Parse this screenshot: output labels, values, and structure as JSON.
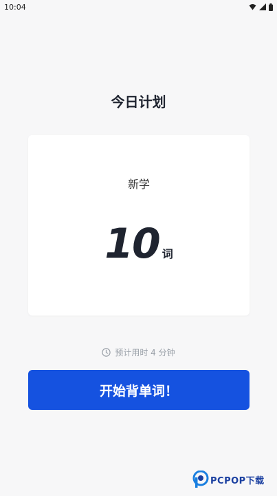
{
  "status_bar": {
    "time": "10:04"
  },
  "page": {
    "title": "今日计划"
  },
  "plan_card": {
    "label": "新学",
    "count": "10",
    "unit": "词"
  },
  "estimate": {
    "text": "预计用时 4 分钟"
  },
  "start_button": {
    "label": "开始背单词！"
  },
  "watermark": {
    "text": "PCPOP下载"
  },
  "colors": {
    "accent": "#1552e0",
    "background": "#f7f7f8",
    "card": "#ffffff",
    "muted_text": "#9aa0a8"
  },
  "icons": [
    "wifi-icon",
    "signal-icon",
    "battery-icon",
    "clock-icon"
  ]
}
